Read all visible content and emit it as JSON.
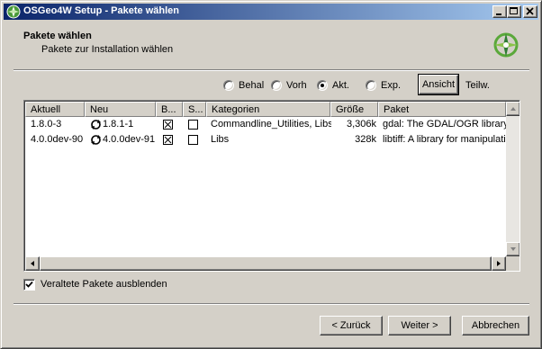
{
  "window": {
    "title": "OSGeo4W Setup - Pakete wählen",
    "app_icon": "osgeo4w-logo-icon",
    "controls": [
      "minimize-icon",
      "maximize-icon",
      "close-icon"
    ]
  },
  "header": {
    "title": "Pakete wählen",
    "subtitle": "Pakete zur Installation wählen",
    "logo": "osgeo4w-logo-icon"
  },
  "view_options": {
    "radios": [
      {
        "label": "Behal",
        "checked": false
      },
      {
        "label": "Vorh",
        "checked": false
      },
      {
        "label": "Akt.",
        "checked": true
      },
      {
        "label": "Exp.",
        "checked": false
      }
    ],
    "view_button": "Ansicht",
    "view_mode": "Teilw."
  },
  "package_list": {
    "columns": [
      "Aktuell",
      "Neu",
      "B...",
      "S...",
      "Kategorien",
      "Größe",
      "Paket"
    ],
    "rows": [
      {
        "current": "1.8.0-3",
        "new": "1.8.1-1",
        "binary": true,
        "source": false,
        "categories": "Commandline_Utilities, Libs",
        "size": "3,306k",
        "package": "gdal: The GDAL/OGR library"
      },
      {
        "current": "4.0.0dev-90",
        "new": "4.0.0dev-91",
        "binary": true,
        "source": false,
        "categories": "Libs",
        "size": "328k",
        "package": "libtiff: A library for manipulating"
      }
    ]
  },
  "hide_obsolete": {
    "label": "Veraltete Pakete ausblenden",
    "checked": true
  },
  "buttons": {
    "back": "< Zurück",
    "next": "Weiter >",
    "cancel": "Abbrechen"
  }
}
